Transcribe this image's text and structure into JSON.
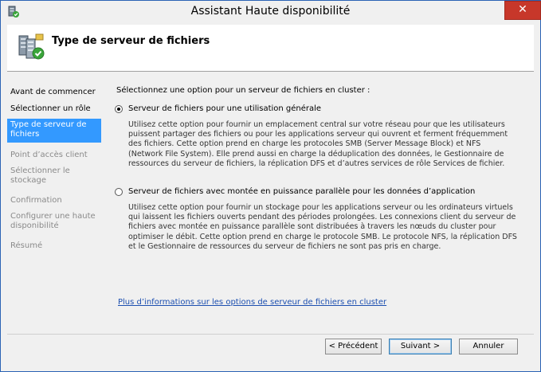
{
  "window": {
    "title": "Assistant Haute disponibilité",
    "close_label": "✕"
  },
  "header": {
    "title": "Type de serveur de fichiers"
  },
  "nav": {
    "items": [
      {
        "label": "Avant de commencer",
        "state": "normal"
      },
      {
        "label": "Sélectionner un rôle",
        "state": "normal"
      },
      {
        "label": "Type de serveur de fichiers",
        "state": "active"
      },
      {
        "label": "Point d’accès client",
        "state": "disabled"
      },
      {
        "label": "Sélectionner le stockage",
        "state": "disabled"
      },
      {
        "label": "Confirmation",
        "state": "disabled"
      },
      {
        "label": "Configurer une haute disponibilité",
        "state": "disabled"
      },
      {
        "label": "Résumé",
        "state": "disabled"
      }
    ]
  },
  "main": {
    "prompt": "Sélectionnez une option pour un serveur de fichiers en cluster :",
    "option1": {
      "label": "Serveur de fichiers pour une utilisation générale",
      "selected": true,
      "description": "Utilisez cette option pour fournir un emplacement central sur votre réseau pour que les utilisateurs puissent partager des fichiers ou pour les applications serveur qui ouvrent et ferment fréquemment des fichiers. Cette option prend en charge les protocoles SMB (Server Message Block) et NFS (Network File System). Elle prend aussi en charge la déduplication des données, le Gestionnaire de ressources du serveur de fichiers, la réplication DFS et d’autres services de rôle Services de fichier."
    },
    "option2": {
      "label": "Serveur de fichiers avec montée en puissance parallèle pour les données d’application",
      "selected": false,
      "description": "Utilisez cette option pour fournir un stockage pour les applications serveur ou les ordinateurs virtuels qui laissent les fichiers ouverts pendant des périodes prolongées. Les connexions client du serveur de fichiers avec montée en puissance parallèle sont distribuées à travers les nœuds du cluster pour optimiser le débit. Cette option prend en charge le protocole SMB. Le protocole NFS, la réplication DFS et le Gestionnaire de ressources du serveur de fichiers ne sont pas pris en charge."
    },
    "more_info_link": "Plus d’informations sur les options de serveur de fichiers en cluster"
  },
  "footer": {
    "prev": "< Précédent",
    "next": "Suivant >",
    "cancel": "Annuler"
  }
}
